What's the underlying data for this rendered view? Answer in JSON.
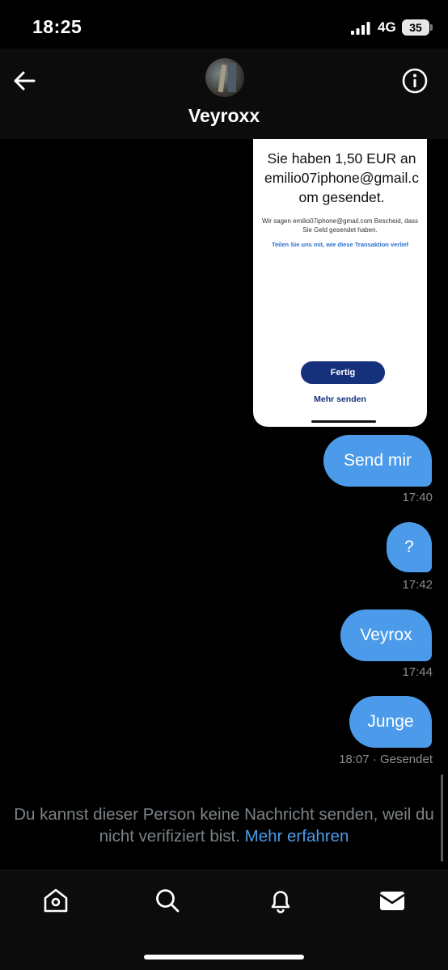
{
  "status_bar": {
    "time": "18:25",
    "network": "4G",
    "battery": "35"
  },
  "header": {
    "contact_name": "Veyroxx",
    "back_icon": "arrow-left-icon",
    "info_icon": "info-circle-icon"
  },
  "attachment": {
    "heading": "Sie haben 1,50 EUR an emilio07iphone@gmail.c om gesendet.",
    "body": "Wir sagen emilio07iphone@gmail.com Bescheid, dass Sie Geld gesendet haben.",
    "link": "Teilen Sie uns mit, wie diese Transaktion verlief",
    "done_button": "Fertig",
    "more_button": "Mehr senden"
  },
  "messages": [
    {
      "text": "Send mir",
      "time": "17:40"
    },
    {
      "text": "?",
      "time": "17:42"
    },
    {
      "text": "Veyrox",
      "time": "17:44"
    },
    {
      "text": "Junge",
      "time": "18:07 · Gesendet"
    }
  ],
  "notice": {
    "text": "Du kannst dieser Person keine Nachricht senden, weil du nicht verifiziert bist.",
    "link": "Mehr erfahren"
  },
  "tabs": [
    {
      "icon": "home-icon"
    },
    {
      "icon": "search-icon"
    },
    {
      "icon": "bell-icon"
    },
    {
      "icon": "mail-icon"
    }
  ],
  "colors": {
    "bubble": "#4b9bea",
    "background": "#000000",
    "muted_text": "#7d8388"
  }
}
